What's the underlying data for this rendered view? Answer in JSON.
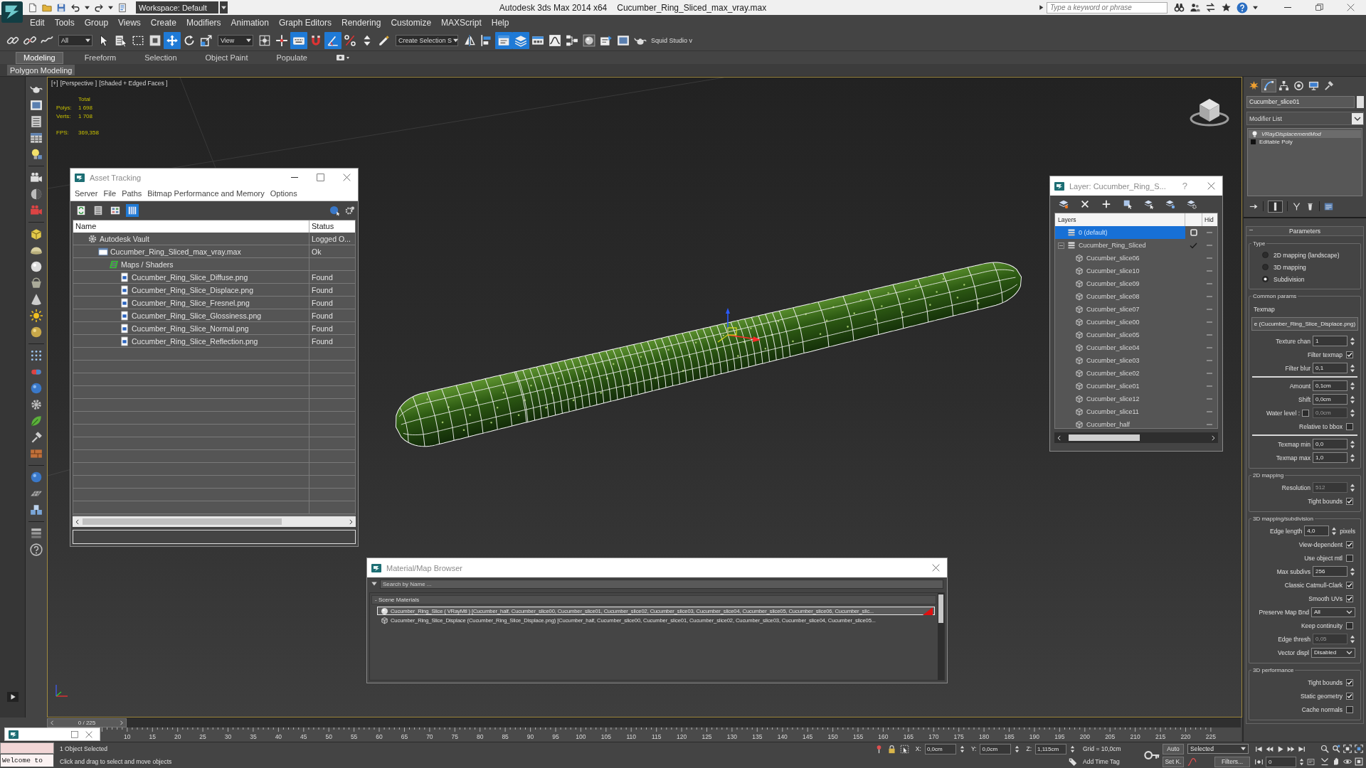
{
  "title_bar": {
    "workspace": "Workspace: Default",
    "app": "Autodesk 3ds Max 2014 x64",
    "file": "Cucumber_Ring_Sliced_max_vray.max",
    "search": {
      "placeholder": "Type a keyword or phrase"
    }
  },
  "menu": [
    "Edit",
    "Tools",
    "Group",
    "Views",
    "Create",
    "Modifiers",
    "Animation",
    "Graph Editors",
    "Rendering",
    "Customize",
    "MAXScript",
    "Help"
  ],
  "toolbar": {
    "selection_filter": "All",
    "reference_coord": "View",
    "named_selection": "Create Selection S",
    "plugin": "Squid Studio v",
    "buttons": [
      {
        "on": false
      },
      {
        "on": false
      },
      {
        "on": false
      },
      {
        "on": false
      },
      {
        "on": false
      },
      {
        "on": false
      },
      {
        "on": false
      },
      {
        "on": true
      },
      {
        "on": false
      },
      {
        "on": false
      },
      {
        "on": false
      },
      {
        "on": false
      },
      {
        "on": true
      },
      {
        "on": false
      },
      {
        "on": true
      },
      {
        "on": false
      },
      {
        "on": false
      },
      {
        "on": false
      },
      {
        "on": false
      },
      {
        "on": false
      },
      {
        "on": true
      },
      {
        "on": true
      },
      {
        "on": false
      },
      {
        "on": false
      },
      {
        "on": false
      },
      {
        "on": false
      },
      {
        "on": false
      },
      {
        "on": false
      },
      {
        "on": false
      }
    ]
  },
  "ribbon": {
    "tabs": [
      {
        "label": "Modeling",
        "selected": true
      },
      {
        "label": "Freeform",
        "selected": false
      },
      {
        "label": "Selection",
        "selected": false
      },
      {
        "label": "Object Paint",
        "selected": false
      },
      {
        "label": "Populate",
        "selected": false
      }
    ],
    "panels": [
      {
        "label": "Polygon Modeling",
        "selected": true
      }
    ]
  },
  "viewport": {
    "labels": [
      "[+]",
      "[Perspective ]",
      "[Shaded + Edged Faces ]"
    ],
    "stats": {
      "heading": "Total",
      "rows": [
        {
          "label": "Polys:",
          "value": "1 698"
        },
        {
          "label": "Verts:",
          "value": "1 708"
        }
      ],
      "fps_label": "FPS:",
      "fps_value": "369,358"
    }
  },
  "asset_tracking": {
    "title": "Asset Tracking",
    "menu": [
      "Server",
      "File",
      "Paths",
      "Bitmap Performance and Memory",
      "Options"
    ],
    "tools": [
      {
        "selected": false
      },
      {
        "selected": false
      },
      {
        "selected": false
      },
      {
        "selected": true
      }
    ],
    "columns": [
      "Name",
      "Status"
    ],
    "rows": [
      {
        "kind": "vault",
        "name": "Autodesk Vault",
        "status": "Logged O...",
        "children": [
          {
            "kind": "scene",
            "name": "Cucumber_Ring_Sliced_max_vray.max",
            "status": "Ok",
            "children": [
              {
                "kind": "folder",
                "name": "Maps / Shaders",
                "children": [
                  {
                    "kind": "bitmap",
                    "name": "Cucumber_Ring_Slice_Diffuse.png",
                    "status": "Found"
                  },
                  {
                    "kind": "bitmap",
                    "name": "Cucumber_Ring_Slice_Displace.png",
                    "status": "Found"
                  },
                  {
                    "kind": "bitmap",
                    "name": "Cucumber_Ring_Slice_Fresnel.png",
                    "status": "Found"
                  },
                  {
                    "kind": "bitmap",
                    "name": "Cucumber_Ring_Slice_Glossiness.png",
                    "status": "Found"
                  },
                  {
                    "kind": "bitmap",
                    "name": "Cucumber_Ring_Slice_Normal.png",
                    "status": "Found"
                  },
                  {
                    "kind": "bitmap",
                    "name": "Cucumber_Ring_Slice_Reflection.png",
                    "status": "Found"
                  }
                ]
              }
            ]
          }
        ]
      }
    ]
  },
  "layer_explorer": {
    "title": "Layer: Cucumber_Ring_S...",
    "help": "?",
    "columns": [
      "Layers",
      "Hid"
    ],
    "rows": [
      {
        "kind": "layer",
        "name": "0 (default)",
        "selected": true,
        "checked": false
      },
      {
        "kind": "layer",
        "name": "Cucumber_Ring_Sliced",
        "selected": false,
        "checked": true,
        "expanded": true,
        "children": [
          {
            "kind": "object",
            "name": "Cucumber_slice06",
            "selected": false
          },
          {
            "kind": "object",
            "name": "Cucumber_slice10",
            "selected": false
          },
          {
            "kind": "object",
            "name": "Cucumber_slice09",
            "selected": false
          },
          {
            "kind": "object",
            "name": "Cucumber_slice08",
            "selected": false
          },
          {
            "kind": "object",
            "name": "Cucumber_slice07",
            "selected": false
          },
          {
            "kind": "object",
            "name": "Cucumber_slice00",
            "selected": false
          },
          {
            "kind": "object",
            "name": "Cucumber_slice05",
            "selected": false
          },
          {
            "kind": "object",
            "name": "Cucumber_slice04",
            "selected": false
          },
          {
            "kind": "object",
            "name": "Cucumber_slice03",
            "selected": false
          },
          {
            "kind": "object",
            "name": "Cucumber_slice02",
            "selected": false
          },
          {
            "kind": "object",
            "name": "Cucumber_slice01",
            "selected": false
          },
          {
            "kind": "object",
            "name": "Cucumber_slice12",
            "selected": false
          },
          {
            "kind": "object",
            "name": "Cucumber_slice11",
            "selected": false
          },
          {
            "kind": "object",
            "name": "Cucumber_half",
            "selected": false
          }
        ]
      }
    ]
  },
  "material_browser": {
    "title": "Material/Map Browser",
    "search": {
      "placeholder": "Search by Name ..."
    },
    "groups": [
      {
        "sign": "-",
        "title": "Scene Materials",
        "items": [
          {
            "kind": "material",
            "label": "Cucumber_Ring_Slice ( VRayMtl ) [Cucumber_half, Cucumber_slice00, Cucumber_slice01, Cucumber_slice02, Cucumber_slice03, Cucumber_slice04, Cucumber_slice05, Cucumber_slice06, Cucumber_slic...",
            "selected": true,
            "flagged": true
          },
          {
            "kind": "map",
            "label": "Cucumber_Ring_Slice_Displace (Cucumber_Ring_Slice_Displace.png) [Cucumber_half, Cucumber_slice00, Cucumber_slice01, Cucumber_slice02, Cucumber_slice03, Cucumber_slice04, Cucumber_slice05...",
            "selected": false,
            "flagged": false
          }
        ]
      }
    ]
  },
  "command_panel": {
    "tabs": [
      {
        "selected": false
      },
      {
        "selected": true
      },
      {
        "selected": false
      },
      {
        "selected": false
      },
      {
        "selected": false
      },
      {
        "selected": false
      }
    ],
    "object_name": "Cucumber_slice01",
    "modifier_list": "Modifier List",
    "stack": [
      {
        "kind": "modifier",
        "label": "VRayDisplacementMod",
        "selected": true
      },
      {
        "kind": "base",
        "label": "Editable Poly",
        "selected": false
      }
    ],
    "rollout": {
      "sign": "–",
      "title": "Parameters"
    },
    "groups": [
      {
        "title": "Type",
        "items": [
          {
            "kind": "radio",
            "label": "2D mapping (landscape)",
            "selected": false
          },
          {
            "kind": "radio",
            "label": "3D mapping",
            "selected": false
          },
          {
            "kind": "radio",
            "label": "Subdivision",
            "selected": true
          }
        ]
      },
      {
        "title": "Common params",
        "items": [
          {
            "kind": "caption",
            "label": "Texmap"
          },
          {
            "kind": "button",
            "label": "e (Cucumber_Ring_Slice_Displace.png)"
          },
          {
            "kind": "spinner",
            "label": "Texture chan",
            "value": "1",
            "disabled": false
          },
          {
            "kind": "check",
            "label": "Filter texmap",
            "checked": true
          },
          {
            "kind": "spinner",
            "label": "Filter blur",
            "value": "0,1",
            "disabled": false
          },
          {
            "kind": "rule"
          },
          {
            "kind": "spinner",
            "label": "Amount",
            "value": "0,1cm",
            "disabled": false
          },
          {
            "kind": "spinner",
            "label": "Shift",
            "value": "0,0cm",
            "disabled": false
          },
          {
            "kind": "check_spinner",
            "label": "Water level :",
            "checked": false,
            "value": "0,0cm",
            "disabled": true
          },
          {
            "kind": "check",
            "label": "Relative to bbox",
            "checked": false
          },
          {
            "kind": "rule"
          },
          {
            "kind": "spinner",
            "label": "Texmap min",
            "value": "0,0",
            "disabled": false
          },
          {
            "kind": "spinner",
            "label": "Texmap max",
            "value": "1,0",
            "disabled": false
          }
        ]
      },
      {
        "title": "2D mapping",
        "items": [
          {
            "kind": "spinner",
            "label": "Resolution",
            "value": "512",
            "disabled": true
          },
          {
            "kind": "check",
            "label": "Tight bounds",
            "checked": true
          }
        ]
      },
      {
        "title": "3D mapping/subdivision",
        "items": [
          {
            "kind": "spinner",
            "label": "Edge length",
            "value": "4,0",
            "unit": "pixels",
            "disabled": false
          },
          {
            "kind": "check",
            "label": "View-dependent",
            "checked": true
          },
          {
            "kind": "check",
            "label": "Use object mtl",
            "checked": false
          },
          {
            "kind": "spinner",
            "label": "Max subdivs",
            "value": "256",
            "disabled": false
          },
          {
            "kind": "check",
            "label": "Classic Catmull-Clark",
            "checked": true
          },
          {
            "kind": "check",
            "label": "Smooth UVs",
            "checked": true
          },
          {
            "kind": "dropdown",
            "label": "Preserve Map Bnd",
            "value": "All"
          },
          {
            "kind": "check",
            "label": "Keep continuity",
            "checked": false
          },
          {
            "kind": "spinner",
            "label": "Edge thresh",
            "value": "0,05",
            "disabled": true
          },
          {
            "kind": "dropdown",
            "label": "Vector displ",
            "value": "Disabled"
          }
        ]
      },
      {
        "title": "3D performance",
        "items": [
          {
            "kind": "check",
            "label": "Tight bounds",
            "checked": true
          },
          {
            "kind": "check",
            "label": "Static geometry",
            "checked": true
          },
          {
            "kind": "check",
            "label": "Cache normals",
            "checked": false
          }
        ]
      }
    ]
  },
  "timeline": {
    "slider": {
      "label": "0 / 225",
      "level": 0
    },
    "ruler": [
      "10",
      "15",
      "20",
      "25",
      "30",
      "35",
      "40",
      "45",
      "50",
      "55",
      "60",
      "65",
      "70",
      "75",
      "80",
      "85",
      "90",
      "95",
      "100",
      "105",
      "110",
      "115",
      "120",
      "125",
      "130",
      "135",
      "140",
      "145",
      "150",
      "155",
      "160",
      "165",
      "170",
      "175",
      "180",
      "185",
      "190",
      "195",
      "200",
      "205",
      "210",
      "215",
      "220",
      "225"
    ]
  },
  "status_bar": {
    "listener": "Welcome to",
    "selection": "1 Object Selected",
    "prompt": "Click and drag to select and move objects",
    "coords": [
      {
        "label": "X:",
        "value": "0,0cm"
      },
      {
        "label": "Y:",
        "value": "0,0cm"
      },
      {
        "label": "Z:",
        "value": "1,115cm"
      }
    ],
    "grid": "Grid = 10,0cm",
    "add_time_tag": "Add Time Tag",
    "auto_key": "Auto",
    "key_filter": "Selected",
    "set_key": "Set K.",
    "filters": "Filters...",
    "frame": "0"
  }
}
